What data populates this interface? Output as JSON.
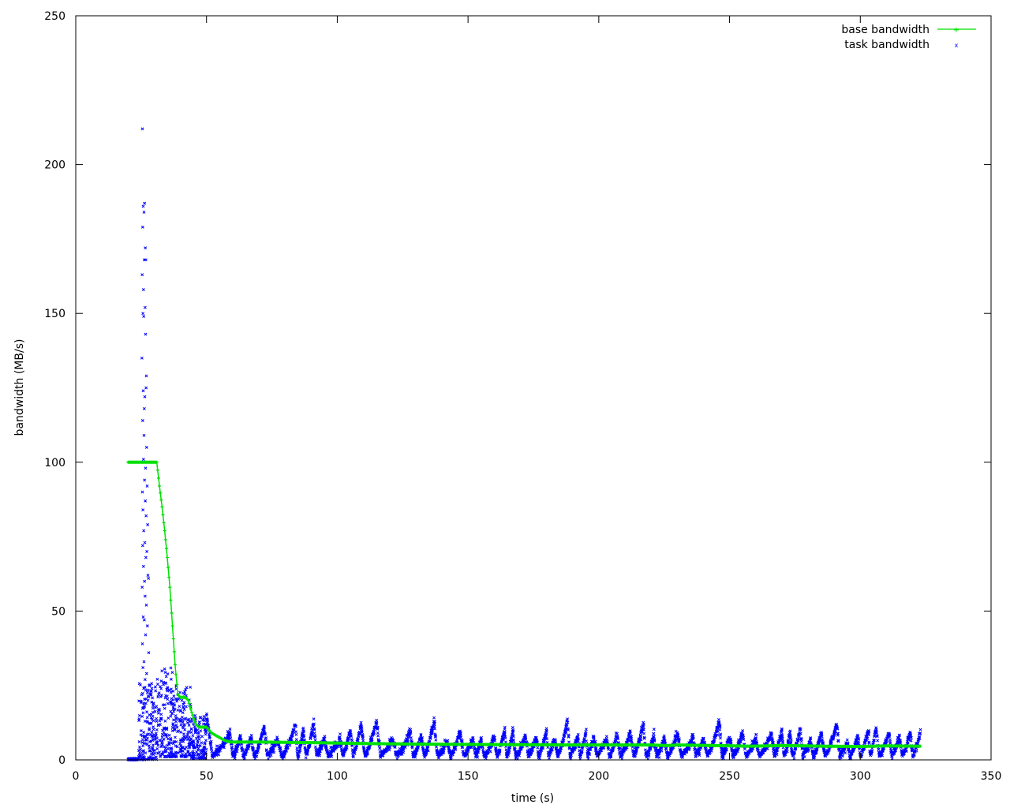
{
  "chart_data": {
    "type": "scatter",
    "title": "",
    "xlabel": "time (s)",
    "ylabel": "bandwidth (MB/s)",
    "xlim": [
      0,
      350
    ],
    "ylim": [
      0,
      250
    ],
    "xticks": [
      "0",
      "50",
      "100",
      "150",
      "200",
      "250",
      "300",
      "350"
    ],
    "yticks": [
      "0",
      "50",
      "100",
      "150",
      "200",
      "250"
    ],
    "grid": false,
    "legend_position": "top-right",
    "series": [
      {
        "name": "base bandwidth",
        "style": "line-with-plus-markers",
        "color": "#00e000",
        "points": [
          [
            20,
            100
          ],
          [
            31,
            100
          ],
          [
            32,
            92
          ],
          [
            33,
            85
          ],
          [
            34,
            77
          ],
          [
            35,
            68
          ],
          [
            36,
            58
          ],
          [
            37,
            45
          ],
          [
            38,
            32
          ],
          [
            39,
            22
          ],
          [
            40,
            21
          ],
          [
            42,
            21
          ],
          [
            43,
            20
          ],
          [
            44,
            17
          ],
          [
            45,
            14
          ],
          [
            46,
            12
          ],
          [
            47,
            11
          ],
          [
            49,
            11
          ],
          [
            50,
            11
          ],
          [
            51,
            10
          ],
          [
            52,
            9
          ],
          [
            53,
            8.5
          ],
          [
            54,
            8
          ],
          [
            56,
            7
          ],
          [
            57,
            6.5
          ],
          [
            59,
            6
          ],
          [
            62,
            6
          ],
          [
            70,
            6
          ],
          [
            90,
            5.8
          ],
          [
            110,
            5.5
          ],
          [
            130,
            5.3
          ],
          [
            150,
            5.2
          ],
          [
            170,
            5.1
          ],
          [
            190,
            5.0
          ],
          [
            210,
            5.0
          ],
          [
            220,
            5.0
          ],
          [
            226,
            4.8
          ],
          [
            230,
            5.0
          ],
          [
            245,
            4.8
          ],
          [
            258,
            4.6
          ],
          [
            270,
            4.8
          ],
          [
            280,
            4.7
          ],
          [
            285,
            4.6
          ],
          [
            300,
            4.5
          ],
          [
            310,
            4.7
          ],
          [
            323,
            4.6
          ]
        ]
      },
      {
        "name": "task bandwidth",
        "style": "x-markers",
        "color": "#0000ff",
        "spike_points": [
          [
            25.5,
            212
          ],
          [
            25.8,
            186
          ],
          [
            26.3,
            187
          ],
          [
            26.1,
            184
          ],
          [
            25.6,
            179
          ],
          [
            26.6,
            172
          ],
          [
            26.2,
            168
          ],
          [
            26.8,
            168
          ],
          [
            25.4,
            163
          ],
          [
            25.9,
            158
          ],
          [
            26.5,
            152
          ],
          [
            25.7,
            150
          ],
          [
            26.0,
            149
          ],
          [
            26.7,
            143
          ],
          [
            25.3,
            135
          ],
          [
            27.0,
            129
          ],
          [
            26.9,
            125
          ],
          [
            25.8,
            124
          ],
          [
            26.4,
            122
          ],
          [
            26.2,
            118
          ],
          [
            25.6,
            114
          ],
          [
            26.1,
            109
          ],
          [
            27.1,
            105
          ],
          [
            25.9,
            101
          ],
          [
            26.7,
            98
          ],
          [
            26.3,
            94
          ],
          [
            27.3,
            92
          ],
          [
            25.5,
            90
          ],
          [
            26.6,
            87
          ],
          [
            25.7,
            84
          ],
          [
            26.9,
            82
          ],
          [
            27.5,
            79
          ],
          [
            26.0,
            77
          ],
          [
            26.4,
            73
          ],
          [
            25.6,
            72
          ],
          [
            27.2,
            70
          ],
          [
            26.8,
            68
          ],
          [
            25.9,
            65
          ],
          [
            27.6,
            62
          ],
          [
            26.3,
            60
          ],
          [
            27.8,
            61
          ],
          [
            25.4,
            58
          ],
          [
            26.5,
            55
          ],
          [
            27.0,
            52
          ],
          [
            25.8,
            48
          ],
          [
            26.2,
            47
          ],
          [
            27.4,
            45
          ],
          [
            26.7,
            42
          ],
          [
            25.5,
            39
          ],
          [
            27.9,
            36
          ],
          [
            26.1,
            33
          ],
          [
            25.7,
            31
          ],
          [
            27.1,
            29
          ],
          [
            26.5,
            27
          ],
          [
            28.2,
            25
          ],
          [
            26.0,
            24
          ],
          [
            28.8,
            22
          ],
          [
            27.6,
            20
          ],
          [
            26.3,
            18
          ],
          [
            29.5,
            16
          ]
        ],
        "clusters": [
          {
            "t0": 20,
            "t1": 24,
            "lo": 0,
            "hi": 0.5
          },
          {
            "t0": 24,
            "t1": 31,
            "lo": 0,
            "hi": 26
          },
          {
            "t0": 31,
            "t1": 37,
            "lo": 1,
            "hi": 31
          },
          {
            "t0": 37,
            "t1": 44,
            "lo": 1,
            "hi": 26
          },
          {
            "t0": 44,
            "t1": 50,
            "lo": 0.5,
            "hi": 15
          }
        ],
        "wave": {
          "t0": 50,
          "t1": 323,
          "peaks": [
            [
              50,
              15
            ],
            [
              59,
              9
            ],
            [
              63,
              7.5
            ],
            [
              67,
              7
            ],
            [
              72,
              11
            ],
            [
              77,
              7
            ],
            [
              84,
              12
            ],
            [
              87,
              10
            ],
            [
              91,
              13
            ],
            [
              95,
              7
            ],
            [
              101,
              7
            ],
            [
              105,
              10
            ],
            [
              109,
              12
            ],
            [
              115,
              13
            ],
            [
              121,
              7
            ],
            [
              128,
              9.5
            ],
            [
              132,
              8
            ],
            [
              137,
              13
            ],
            [
              142,
              6
            ],
            [
              147,
              9.5
            ],
            [
              152,
              7
            ],
            [
              155,
              6.5
            ],
            [
              160,
              8
            ],
            [
              164,
              10
            ],
            [
              167,
              9
            ],
            [
              172,
              8
            ],
            [
              176,
              7.5
            ],
            [
              180,
              10
            ],
            [
              183,
              7
            ],
            [
              188,
              13
            ],
            [
              192,
              8
            ],
            [
              195,
              9
            ],
            [
              198,
              8
            ],
            [
              203,
              7
            ],
            [
              207,
              8.5
            ],
            [
              212,
              9
            ],
            [
              217,
              12
            ],
            [
              221,
              8
            ],
            [
              225,
              7
            ],
            [
              230,
              9
            ],
            [
              236,
              8
            ],
            [
              240,
              7
            ],
            [
              246,
              13
            ],
            [
              250,
              8
            ],
            [
              255,
              9
            ],
            [
              260,
              7
            ],
            [
              266,
              9
            ],
            [
              270,
              10
            ],
            [
              273,
              9
            ],
            [
              277,
              10.5
            ],
            [
              281,
              7
            ],
            [
              285,
              9
            ],
            [
              291,
              12
            ],
            [
              295,
              6
            ],
            [
              299,
              8
            ],
            [
              303,
              10
            ],
            [
              306,
              11
            ],
            [
              311,
              9
            ],
            [
              315,
              8
            ],
            [
              319,
              9
            ],
            [
              323,
              9
            ]
          ],
          "floor": 1.5
        }
      }
    ]
  }
}
